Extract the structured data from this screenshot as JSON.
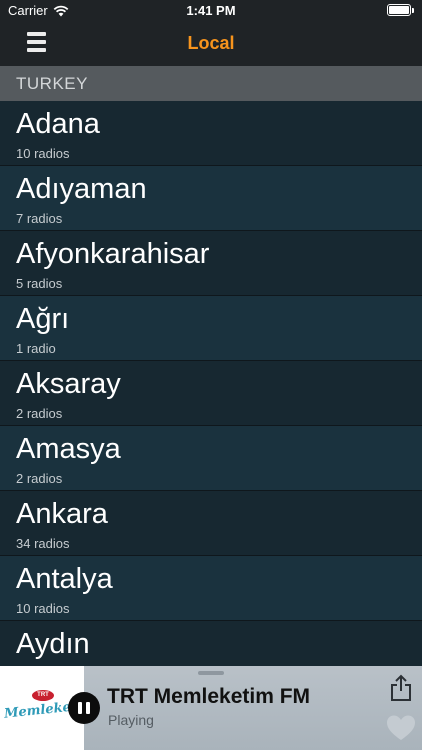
{
  "status_bar": {
    "carrier": "Carrier",
    "time": "1:41 PM",
    "battery_level": 1.0
  },
  "nav": {
    "title": "Local",
    "menu_icon": "hamburger-menu-icon"
  },
  "section": {
    "header": "TURKEY"
  },
  "regions": [
    {
      "name": "Adana",
      "count": "10 radios"
    },
    {
      "name": "Adıyaman",
      "count": "7 radios"
    },
    {
      "name": "Afyonkarahisar",
      "count": "5 radios"
    },
    {
      "name": "Ağrı",
      "count": "1 radio"
    },
    {
      "name": "Aksaray",
      "count": "2 radios"
    },
    {
      "name": "Amasya",
      "count": "2 radios"
    },
    {
      "name": "Ankara",
      "count": "34 radios"
    },
    {
      "name": "Antalya",
      "count": "10 radios"
    },
    {
      "name": "Aydın",
      "count": ""
    }
  ],
  "player": {
    "station_name": "TRT Memleketim FM",
    "status": "Playing",
    "logo_text": "Memleketim",
    "logo_badge": "TRT",
    "play_state_icon": "pause-icon",
    "share_icon": "share-icon",
    "favorite_icon": "heart-icon"
  },
  "colors": {
    "accent": "#f7941d",
    "bar_background": "#1f2326",
    "section_header_bg": "#555a5e",
    "row_odd": "#172831",
    "row_even": "#1a323e",
    "player_bg": "#b1bac2"
  }
}
